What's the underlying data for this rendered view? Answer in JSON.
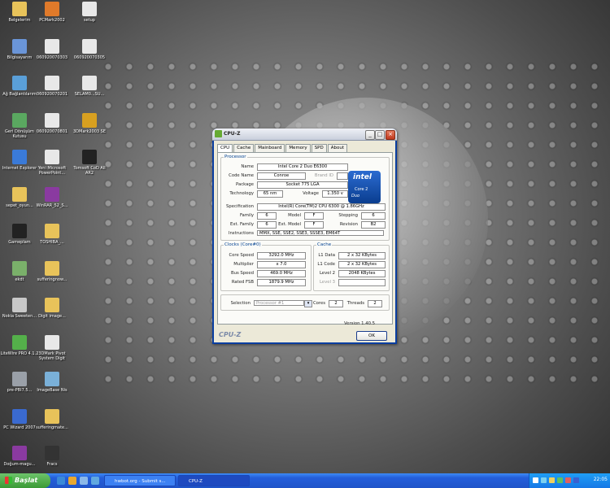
{
  "desktop_icons": [
    {
      "label": "Belgelerim",
      "icon": "folder-icon",
      "color": "#e8c35a"
    },
    {
      "label": "Bilgisayarım",
      "icon": "computer-icon",
      "color": "#6a95d8"
    },
    {
      "label": "Ağ Bağlantılarım",
      "icon": "network-icon",
      "color": "#5a9fd8"
    },
    {
      "label": "Geri Dönüşüm Kutusu",
      "icon": "recycle-bin-icon",
      "color": "#5aa860"
    },
    {
      "label": "Internet Explorer",
      "icon": "internet-explorer-icon",
      "color": "#3a7ad8"
    },
    {
      "label": "sepet_oyun...",
      "icon": "folder-icon",
      "color": "#e8c35a"
    },
    {
      "label": "Gameplam",
      "icon": "game-icon",
      "color": "#222222"
    },
    {
      "label": "ekdt",
      "icon": "eraser-icon",
      "color": "#7ab06a"
    },
    {
      "label": "Nokia Sweeten...",
      "icon": "app-icon",
      "color": "#c8c8c8"
    },
    {
      "label": "LiteWire PRO 4.1.2",
      "icon": "app-icon",
      "color": "#54b04a"
    },
    {
      "label": "pre-PBI7.5...",
      "icon": "app-icon",
      "color": "#9aa0a8"
    },
    {
      "label": "PC Wizard 2007",
      "icon": "app-icon",
      "color": "#3a6ad0"
    },
    {
      "label": "Doğum-magu...",
      "icon": "archive-icon",
      "color": "#8a3aa0"
    },
    {
      "label": "PCMark2002",
      "icon": "app-icon",
      "color": "#e07a2a"
    },
    {
      "label": "060920070303",
      "icon": "document-icon",
      "color": "#e8e8e8"
    },
    {
      "label": "060920070201",
      "icon": "document-icon",
      "color": "#e8e8e8"
    },
    {
      "label": "060920070801",
      "icon": "document-icon",
      "color": "#e8e8e8"
    },
    {
      "label": "Yeni Microsoft PowerPoint...",
      "icon": "powerpoint-icon",
      "color": "#e8e8e8"
    },
    {
      "label": "WinRAR_52_S...",
      "icon": "archive-icon",
      "color": "#8a3aa0"
    },
    {
      "label": "TOSHIBA_...",
      "icon": "folder-icon",
      "color": "#e8c35a"
    },
    {
      "label": "sufferingnow...",
      "icon": "folder-icon",
      "color": "#e8c35a"
    },
    {
      "label": "Digit image...",
      "icon": "folder-icon",
      "color": "#e8c35a"
    },
    {
      "label": "3DMark Pivot System Digit",
      "icon": "app-icon",
      "color": "#e8e8e8"
    },
    {
      "label": "ImageBase Nis",
      "icon": "app-icon",
      "color": "#7ab0d8"
    },
    {
      "label": "sufferingmate...",
      "icon": "folder-icon",
      "color": "#e8c35a"
    },
    {
      "label": "Fracs",
      "icon": "app-icon",
      "color": "#333333"
    },
    {
      "label": "setup",
      "icon": "setup-icon",
      "color": "#e8e8e8"
    },
    {
      "label": "060920070305",
      "icon": "document-icon",
      "color": "#e8e8e8"
    },
    {
      "label": "SELAM0...SU...",
      "icon": "document-icon",
      "color": "#e8e8e8"
    },
    {
      "label": "3DMark2003 SE",
      "icon": "app-icon",
      "color": "#d8a020"
    },
    {
      "label": "Tomsoft CoD All AR2",
      "icon": "app-icon",
      "color": "#222222"
    }
  ],
  "window": {
    "title": "CPU-Z",
    "tabs": [
      "CPU",
      "Cache",
      "Mainboard",
      "Memory",
      "SPD",
      "About"
    ],
    "processor": {
      "legend": "Processor",
      "name_label": "Name",
      "name": "Intel Core 2 Duo E6300",
      "codename_label": "Code Name",
      "codename": "Conroe",
      "brandid_label": "Brand ID",
      "package_label": "Package",
      "package": "Socket 775 LGA",
      "technology_label": "Technology",
      "technology": "65 nm",
      "voltage_label": "Voltage",
      "voltage": "1.350 v",
      "spec_label": "Specification",
      "spec": "Intel(R) Core(TM)2 CPU       6300  @ 1.86GHz",
      "family_label": "Family",
      "family": "6",
      "model_label": "Model",
      "model": "F",
      "stepping_label": "Stepping",
      "stepping": "6",
      "extfamily_label": "Ext. Family",
      "extfamily": "6",
      "extmodel_label": "Ext. Model",
      "extmodel": "F",
      "revision_label": "Revision",
      "revision": "B2",
      "instructions_label": "Instructions",
      "instructions": "MMX, SSE, SSE2, SSE3, SSSE3, EM64T"
    },
    "logo": {
      "brand": "intel",
      "line1": "Core 2",
      "line2": "Duo"
    },
    "clocks": {
      "legend": "Clocks (Core#0)",
      "corespeed_label": "Core Speed",
      "corespeed": "3292.0 MHz",
      "multiplier_label": "Multiplier",
      "multiplier": "x 7.0",
      "busspeed_label": "Bus Speed",
      "busspeed": "469.0 MHz",
      "ratedfsb_label": "Rated FSB",
      "ratedfsb": "1879.9 MHz"
    },
    "cache": {
      "legend": "Cache",
      "l1data_label": "L1 Data",
      "l1data": "2 x 32 KBytes",
      "l1code_label": "L1 Code",
      "l1code": "2 x 32 KBytes",
      "level2_label": "Level 2",
      "level2": "2048 KBytes",
      "level3_label": "Level 3",
      "level3": ""
    },
    "selection_label": "Selection",
    "selection_value": "Processor #1",
    "cores_label": "Cores",
    "cores": "2",
    "threads_label": "Threads",
    "threads": "2",
    "version": "Version 1.40.5",
    "footer_brand": "CPU-Z",
    "ok_label": "OK"
  },
  "taskbar": {
    "start_label": "Başlat",
    "items": [
      {
        "label": "hwbot.org - Submit s..."
      },
      {
        "label": "CPU-Z"
      }
    ],
    "clock": "22:05"
  }
}
